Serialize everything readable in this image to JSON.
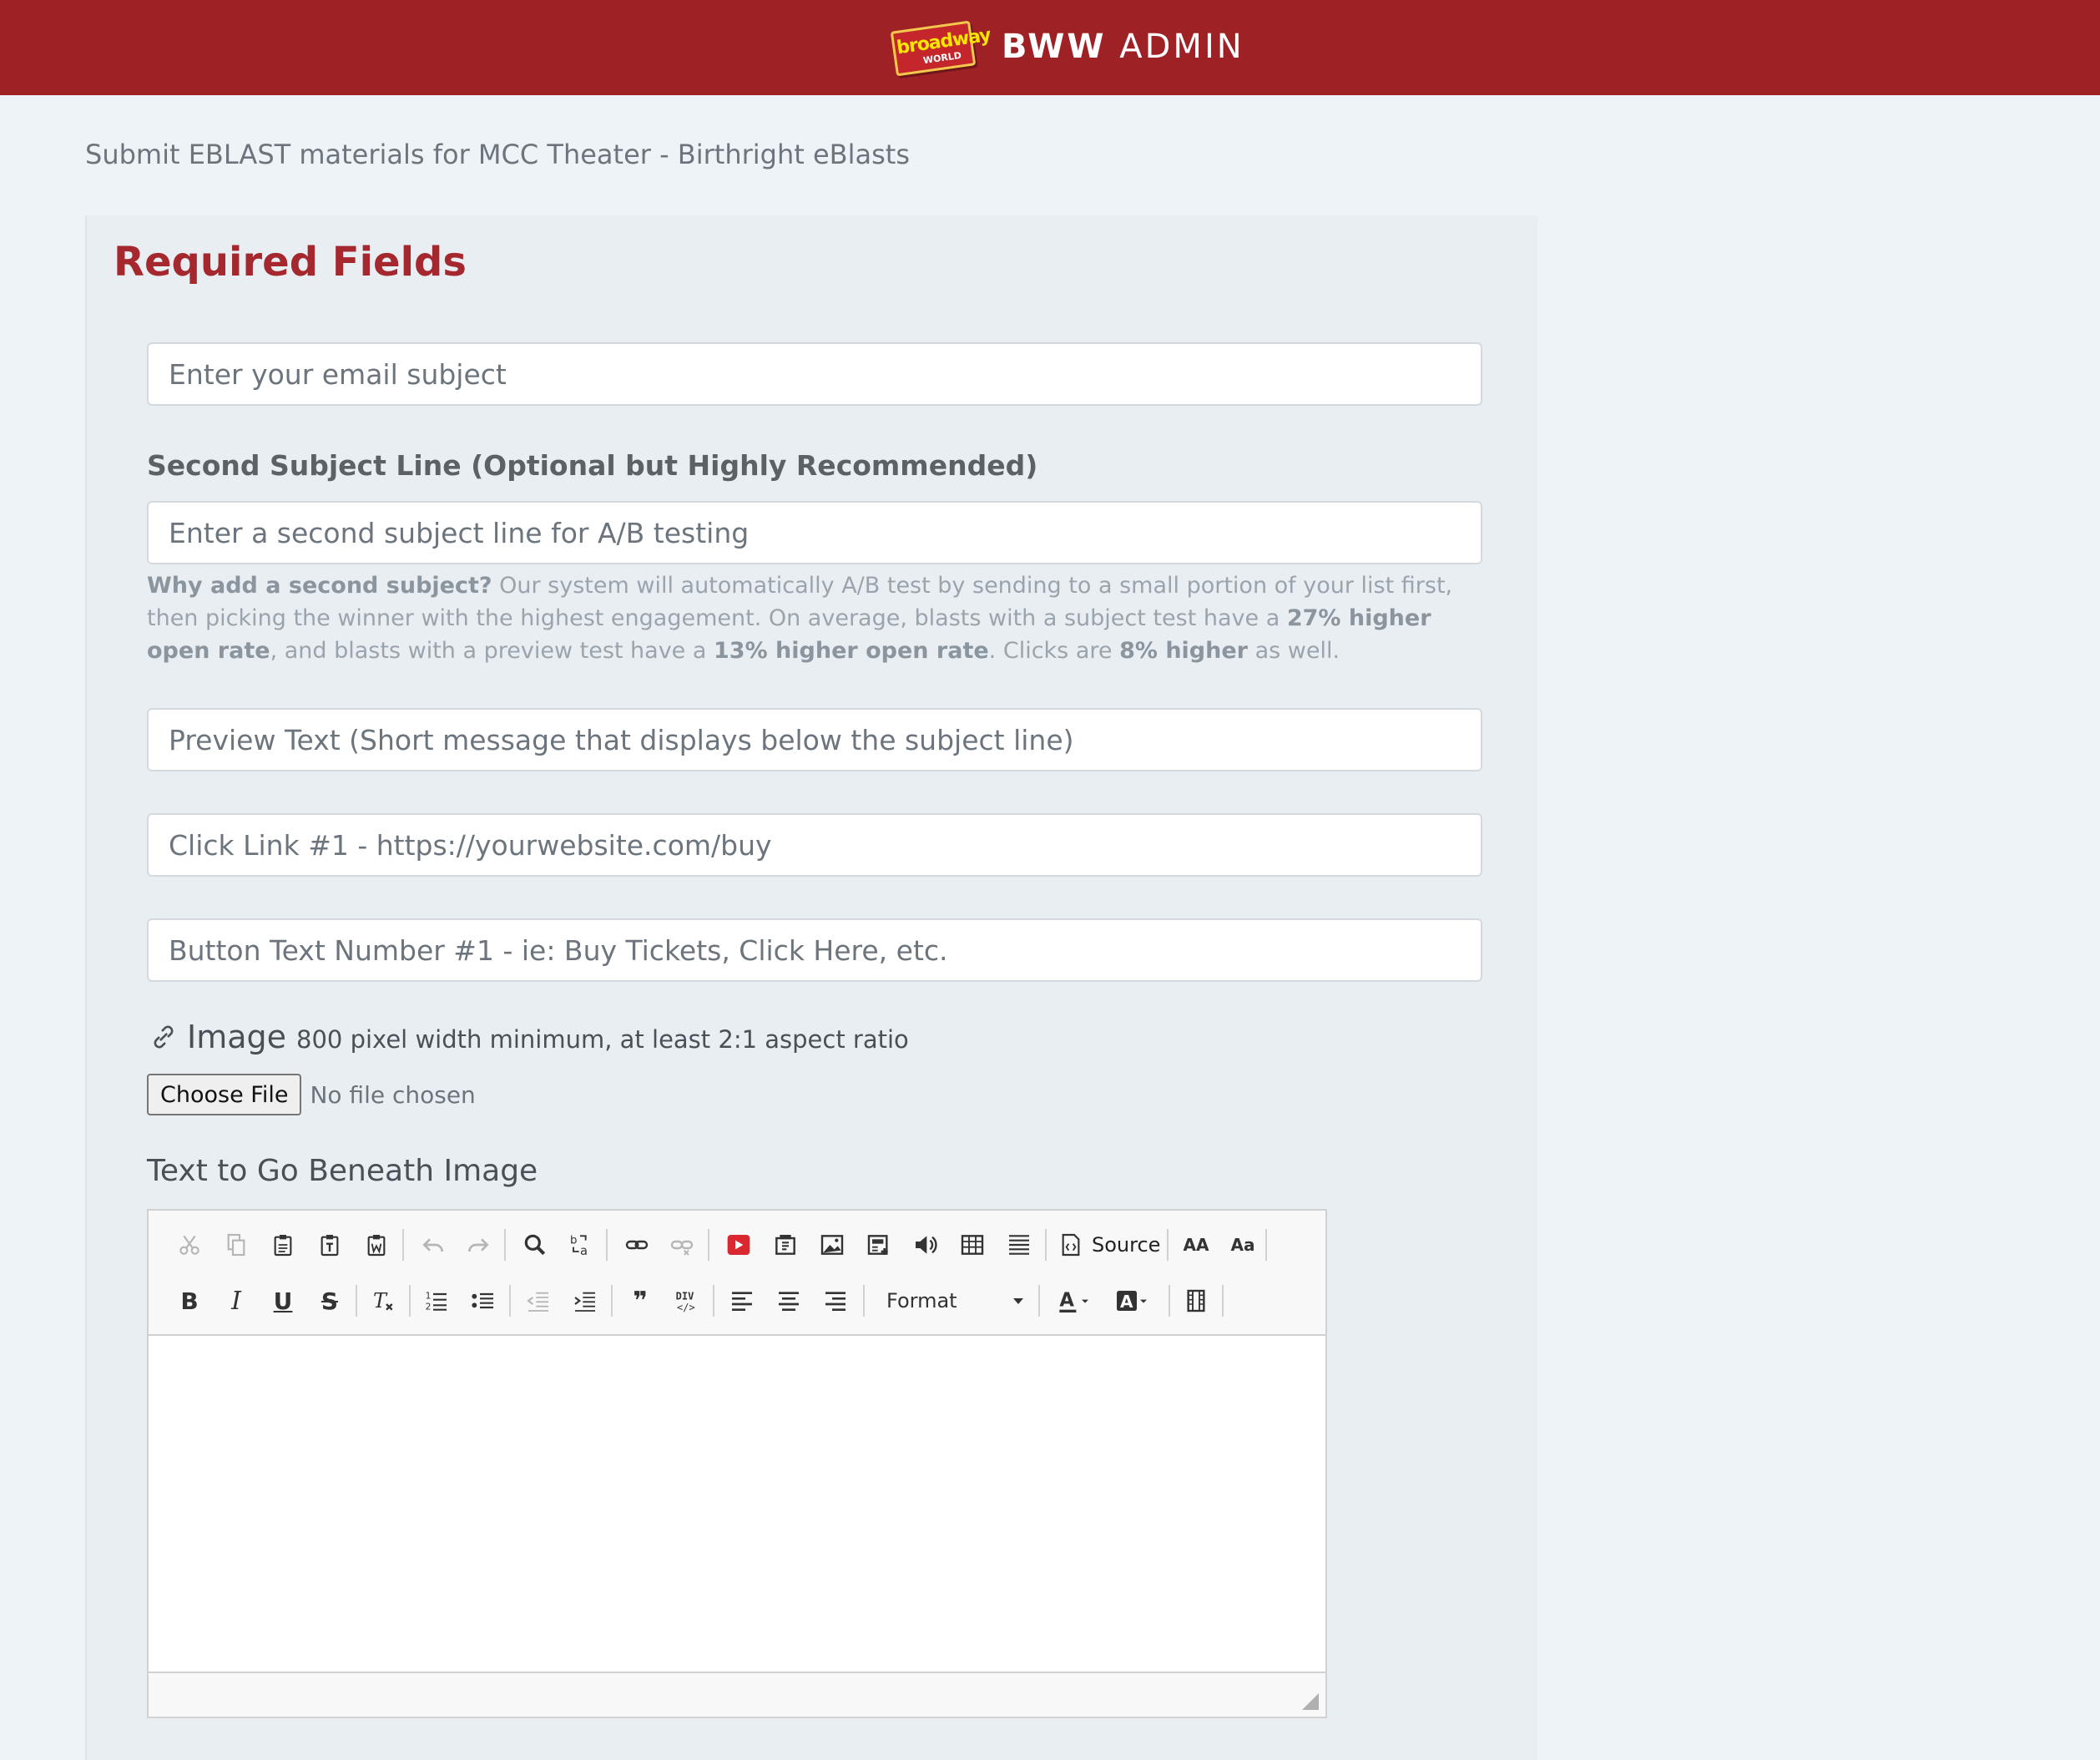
{
  "header": {
    "logo_line1": "broadway",
    "logo_line2": "WORLD",
    "brand_bold": "BWW",
    "brand_light": "ADMIN"
  },
  "page": {
    "title": "Submit EBLAST materials for MCC Theater - Birthright eBlasts"
  },
  "form": {
    "section_title": "Required Fields",
    "subject_placeholder": "Enter your email subject",
    "second_subject_label": "Second Subject Line (Optional but Highly Recommended)",
    "second_subject_placeholder": "Enter a second subject line for A/B testing",
    "help": {
      "lead": "Why add a second subject?",
      "t1": " Our system will automatically A/B test by sending to a small portion of your list first, then picking the winner with the highest engagement. On average, blasts with a subject test have a ",
      "b1": "27% higher open rate",
      "t2": ", and blasts with a preview test have a ",
      "b2": "13% higher open rate",
      "t3": ". Clicks are ",
      "b3": "8% higher",
      "t4": " as well."
    },
    "preview_placeholder": "Preview Text (Short message that displays below the subject line)",
    "link_placeholder": "Click Link #1 - https://yourwebsite.com/buy",
    "button_text_placeholder": "Button Text Number #1 - ie: Buy Tickets, Click Here, etc.",
    "image_label": "Image",
    "image_hint": "800 pixel width minimum, at least 2:1 aspect ratio",
    "choose_file": "Choose File",
    "no_file": "No file chosen",
    "beneath_label": "Text to Go Beneath Image"
  },
  "editor": {
    "source_label": "Source",
    "format_label": "Format",
    "bold_glyph": "B",
    "italic_glyph": "I",
    "underline_glyph": "U",
    "strike_glyph": "S",
    "quote_glyph": "❞",
    "uppercase_glyph": "AA",
    "capitalize_glyph": "Aa",
    "icons": [
      "cut-icon",
      "copy-icon",
      "paste-icon",
      "paste-text-icon",
      "paste-word-icon",
      "undo-icon",
      "redo-icon",
      "find-icon",
      "replace-icon",
      "link-icon",
      "unlink-icon",
      "youtube-icon",
      "flash-icon",
      "image-icon",
      "template-icon",
      "audio-icon",
      "table-icon",
      "horizontal-rule-icon",
      "source-icon",
      "remove-format-icon",
      "numbered-list-icon",
      "bulleted-list-icon",
      "outdent-icon",
      "indent-icon",
      "blockquote-icon",
      "div-container-icon",
      "align-left-icon",
      "align-center-icon",
      "align-right-icon",
      "text-color-icon",
      "background-color-icon",
      "video-icon"
    ]
  },
  "colors": {
    "header_bg": "#9e2126",
    "section_title": "#a4282d",
    "page_bg": "#eef3f7"
  }
}
